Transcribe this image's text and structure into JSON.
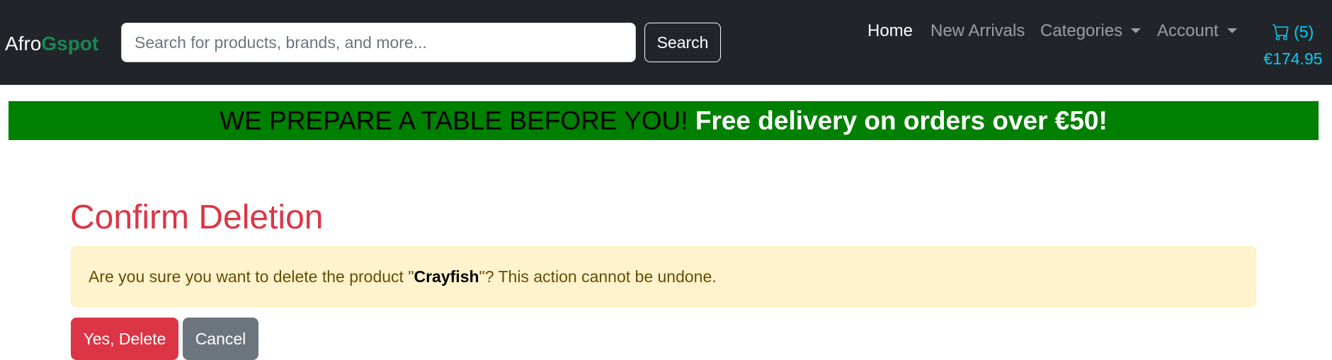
{
  "brand": {
    "name_plain": "Afro",
    "name_accent": "Gspot"
  },
  "search": {
    "placeholder": "Search for products, brands, and more...",
    "value": "",
    "button_label": "Search"
  },
  "nav": {
    "home": "Home",
    "new_arrivals": "New Arrivals",
    "categories": "Categories",
    "account": "Account"
  },
  "cart": {
    "count": "(5)",
    "total": "€174.95"
  },
  "promo": {
    "text_dark": "WE PREPARE A TABLE BEFORE YOU!",
    "text_bright": "Free delivery on orders over €50!"
  },
  "page": {
    "title": "Confirm Deletion",
    "message_prefix": "Are you sure you want to delete the product \"",
    "product_name": "Crayfish",
    "message_suffix": "\"? This action cannot be undone.",
    "confirm_label": "Yes, Delete",
    "cancel_label": "Cancel"
  },
  "colors": {
    "navbar_bg": "#212529",
    "brand_accent": "#198754",
    "cart": "#0dcaf0",
    "promo_bg": "#008000",
    "title": "#dc3545",
    "alert_bg": "#fff3cd",
    "danger": "#dc3545",
    "secondary": "#6c757d"
  },
  "icons": {
    "cart": "cart-icon",
    "dropdown": "chevron-down-icon"
  }
}
